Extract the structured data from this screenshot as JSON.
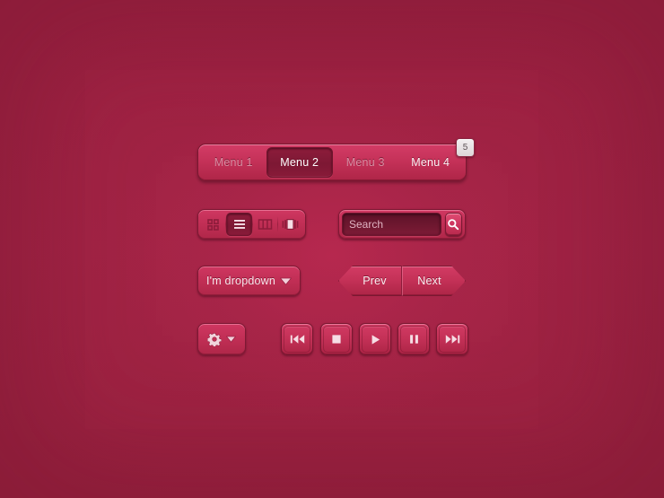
{
  "theme": {
    "background": "#9c2141",
    "accent": "#c43157",
    "accent_light": "#d33c66",
    "accent_dark": "#7d1834",
    "text_light": "#fdf2f5",
    "text_dim": "#d98ca2",
    "badge_bg": "#eeeaec",
    "badge_text": "#5d5457"
  },
  "menubar": {
    "name": "menu-bar",
    "items": [
      {
        "label": "Menu 1",
        "state": "normal"
      },
      {
        "label": "Menu 2",
        "state": "active"
      },
      {
        "label": "Menu 3",
        "state": "normal"
      },
      {
        "label": "Menu 4",
        "state": "hover"
      }
    ],
    "badge": {
      "value": "5",
      "icon": "notification-badge"
    }
  },
  "viewbar": {
    "name": "view-mode-toolbar",
    "buttons": [
      {
        "icon": "grid-view-icon",
        "label": "Grid view",
        "state": "normal"
      },
      {
        "icon": "list-view-icon",
        "label": "List view",
        "state": "active"
      },
      {
        "icon": "column-view-icon",
        "label": "Column view",
        "state": "normal"
      },
      {
        "icon": "coverflow-view-icon",
        "label": "Cover flow view",
        "state": "normal"
      }
    ]
  },
  "search": {
    "name": "search-field",
    "value": "",
    "placeholder": "Search",
    "button_icon": "search-icon",
    "button_label": "Search"
  },
  "dropdown": {
    "name": "dropdown-select",
    "label": "I'm dropdown",
    "arrow_icon": "chevron-down-icon"
  },
  "pager": {
    "name": "prev-next-group",
    "prev_label": "Prev",
    "next_label": "Next"
  },
  "gear": {
    "name": "settings-split-button",
    "icon": "gear-icon",
    "arrow_icon": "chevron-down-icon",
    "label": "Settings"
  },
  "media": {
    "name": "media-transport-controls",
    "buttons": [
      {
        "icon": "rewind-icon",
        "label": "Previous track"
      },
      {
        "icon": "stop-icon",
        "label": "Stop"
      },
      {
        "icon": "play-icon",
        "label": "Play"
      },
      {
        "icon": "pause-icon",
        "label": "Pause"
      },
      {
        "icon": "fast-forward-icon",
        "label": "Next track"
      }
    ]
  }
}
